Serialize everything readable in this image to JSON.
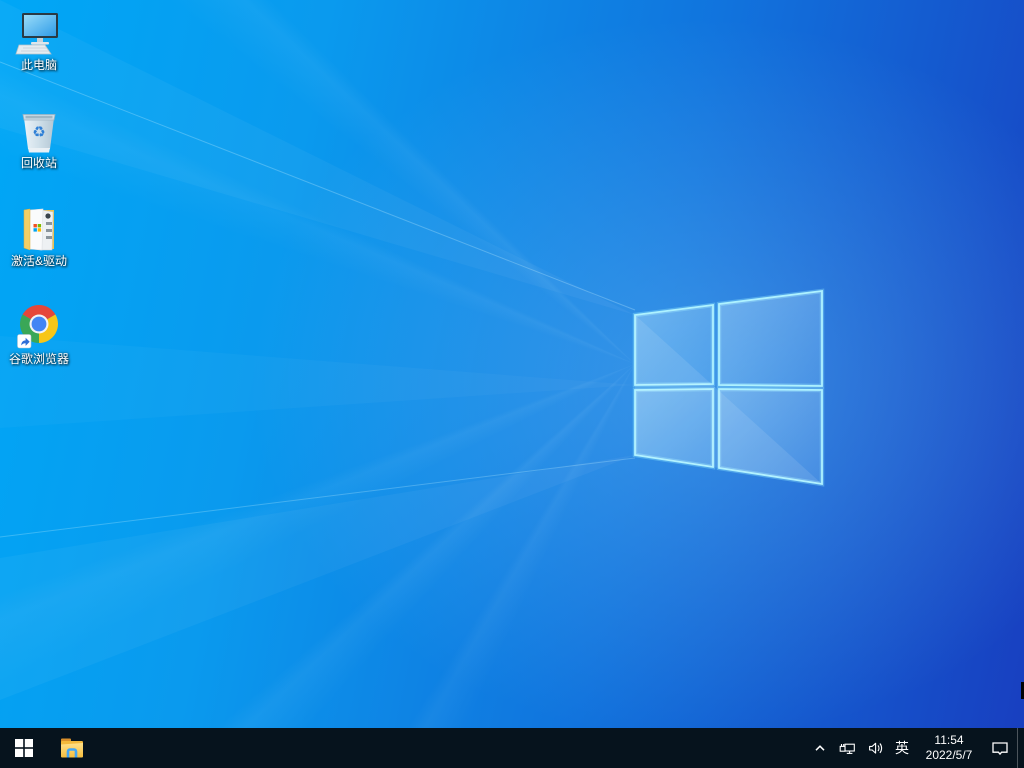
{
  "meta": {
    "os_screen": "Windows 10 desktop"
  },
  "wallpaper": {
    "base_left_color": "#00a7f6",
    "base_right_color": "#183fc0",
    "logo_border_color": "#a5eeff",
    "logo_fill_color": "rgba(205,240,255,0.30)"
  },
  "glyphs": {
    "recycle": "♻"
  },
  "desktop_icons": [
    {
      "id": "this-pc",
      "label": "此电脑"
    },
    {
      "id": "recycle-bin",
      "label": "回收站"
    },
    {
      "id": "activation-drivers",
      "label": "激活&驱动"
    },
    {
      "id": "google-chrome",
      "label": "谷歌浏览器"
    }
  ],
  "taskbar": {
    "background_color": "#06131d",
    "tray": {
      "ime_indicator": "英",
      "clock": {
        "time": "11:54",
        "date": "2022/5/7"
      }
    }
  }
}
